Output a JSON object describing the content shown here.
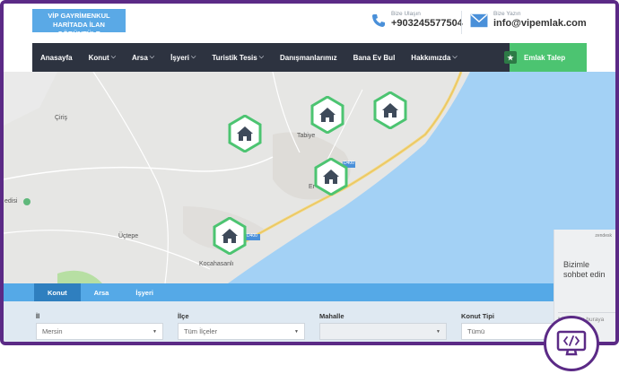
{
  "header": {
    "logo_line1": "VİP GAYRİMENKUL",
    "logo_line2": "HARİTADA İLAN GÖRÜNTÜLE",
    "phone_label": "Bize Ulaşın",
    "phone_value": "+903245577504",
    "mail_label": "Bize Yazın",
    "mail_value": "info@vipemlak.com"
  },
  "nav": {
    "items": [
      {
        "label": "Anasayfa",
        "has_dropdown": false
      },
      {
        "label": "Konut",
        "has_dropdown": true
      },
      {
        "label": "Arsa",
        "has_dropdown": true
      },
      {
        "label": "İşyeri",
        "has_dropdown": true
      },
      {
        "label": "Turistik Tesis",
        "has_dropdown": true
      },
      {
        "label": "Danışmanlarımız",
        "has_dropdown": false
      },
      {
        "label": "Bana Ev Bul",
        "has_dropdown": false
      },
      {
        "label": "Hakkımızda",
        "has_dropdown": true
      }
    ],
    "cta_label": "Emlak Talep"
  },
  "map": {
    "labels": {
      "ciris": "Çiriş",
      "tabiye": "Tabiye",
      "uctepe": "Üçtepe",
      "kocahasanli": "Kocahasanlı",
      "erdemli_partial": "Er",
      "road_d400": "D400",
      "road_d400b": "D400",
      "edisi_partial": "edisi"
    },
    "marker_icon": "house-icon"
  },
  "search": {
    "tabs": [
      "Konut",
      "Arsa",
      "İşyeri"
    ],
    "active_tab": 0,
    "fields": [
      {
        "label": "İl",
        "value": "Mersin"
      },
      {
        "label": "İlçe",
        "value": "Tüm İlçeler"
      },
      {
        "label": "Mahalle",
        "value": ""
      },
      {
        "label": "Konut Tipi",
        "value": "Tümü"
      }
    ]
  },
  "chat": {
    "brand": "zendesk",
    "greeting": "Bizimle sohbet edin",
    "placeholder": "Mesajınızı buraya"
  },
  "colors": {
    "frame": "#5b2a86",
    "nav_bg": "#2d3340",
    "cta": "#4cc471",
    "sea": "#a3d1f5",
    "tab_bar": "#55a9e7",
    "marker": "#4cc471"
  }
}
